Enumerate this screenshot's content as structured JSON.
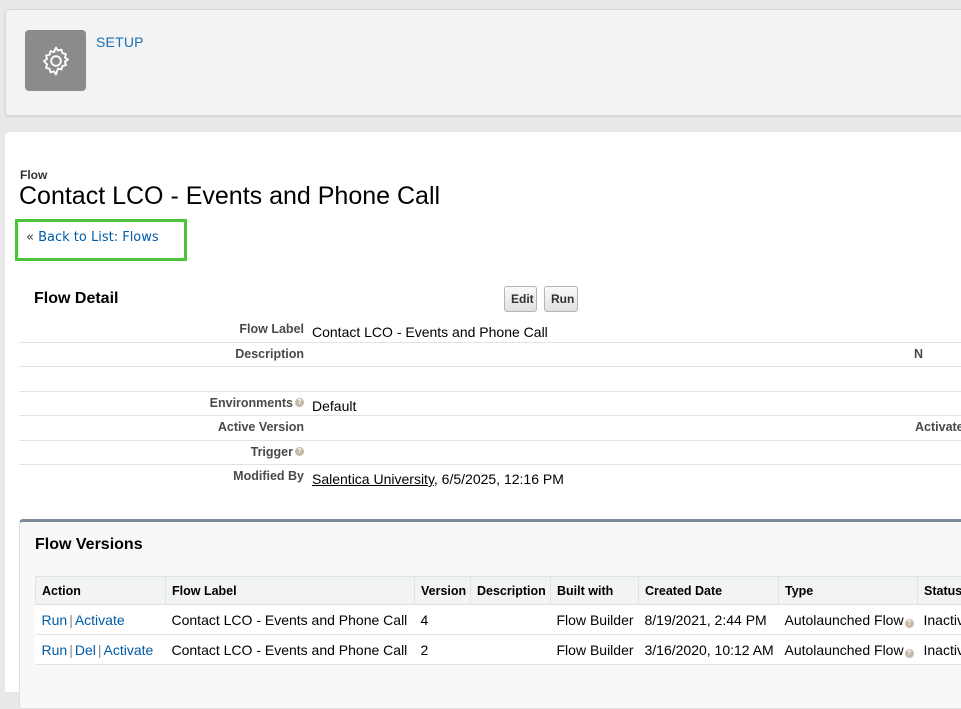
{
  "header": {
    "title": "SETUP",
    "icon": "gear-icon"
  },
  "page": {
    "kind": "Flow",
    "title": "Contact LCO - Events and Phone Call",
    "back_link": {
      "prefix": "«",
      "label": "Back to List: Flows"
    }
  },
  "detail": {
    "section_title": "Flow Detail",
    "buttons": {
      "edit": "Edit",
      "run": "Run"
    },
    "rows": {
      "flow_label": {
        "label": "Flow Label",
        "value": "Contact LCO - Events and Phone Call"
      },
      "description": {
        "label": "Description",
        "value": "",
        "right_label": "N"
      },
      "environments": {
        "label": "Environments",
        "value": "Default"
      },
      "active_version": {
        "label": "Active Version",
        "value": "",
        "right_label": "Activate"
      },
      "trigger": {
        "label": "Trigger",
        "value": ""
      },
      "modified_by": {
        "label": "Modified By",
        "user": "Salentica University",
        "date": ", 6/5/2025, 12:16 PM"
      }
    }
  },
  "versions": {
    "section_title": "Flow Versions",
    "columns": {
      "action": "Action",
      "flow_label": "Flow Label",
      "version": "Version",
      "description": "Description",
      "built_with": "Built with",
      "created_date": "Created Date",
      "type": "Type",
      "status": "Status"
    },
    "rows": [
      {
        "actions": {
          "run": "Run",
          "activate": "Activate"
        },
        "flow_label": "Contact LCO - Events and Phone Call",
        "version": "4",
        "description": "",
        "built_with": "Flow Builder",
        "created_date": "8/19/2021, 2:44 PM",
        "type": "Autolaunched Flow",
        "status": "Inactiv"
      },
      {
        "actions": {
          "run": "Run",
          "del": "Del",
          "activate": "Activate"
        },
        "flow_label": "Contact LCO - Events and Phone Call",
        "version": "2",
        "description": "",
        "built_with": "Flow Builder",
        "created_date": "3/16/2020, 10:12 AM",
        "type": "Autolaunched Flow",
        "status": "Inactiv"
      }
    ]
  },
  "colors": {
    "link": "#015ba7",
    "highlight_box": "#4cc33a",
    "header_icon_bg": "#8b8b8b"
  }
}
